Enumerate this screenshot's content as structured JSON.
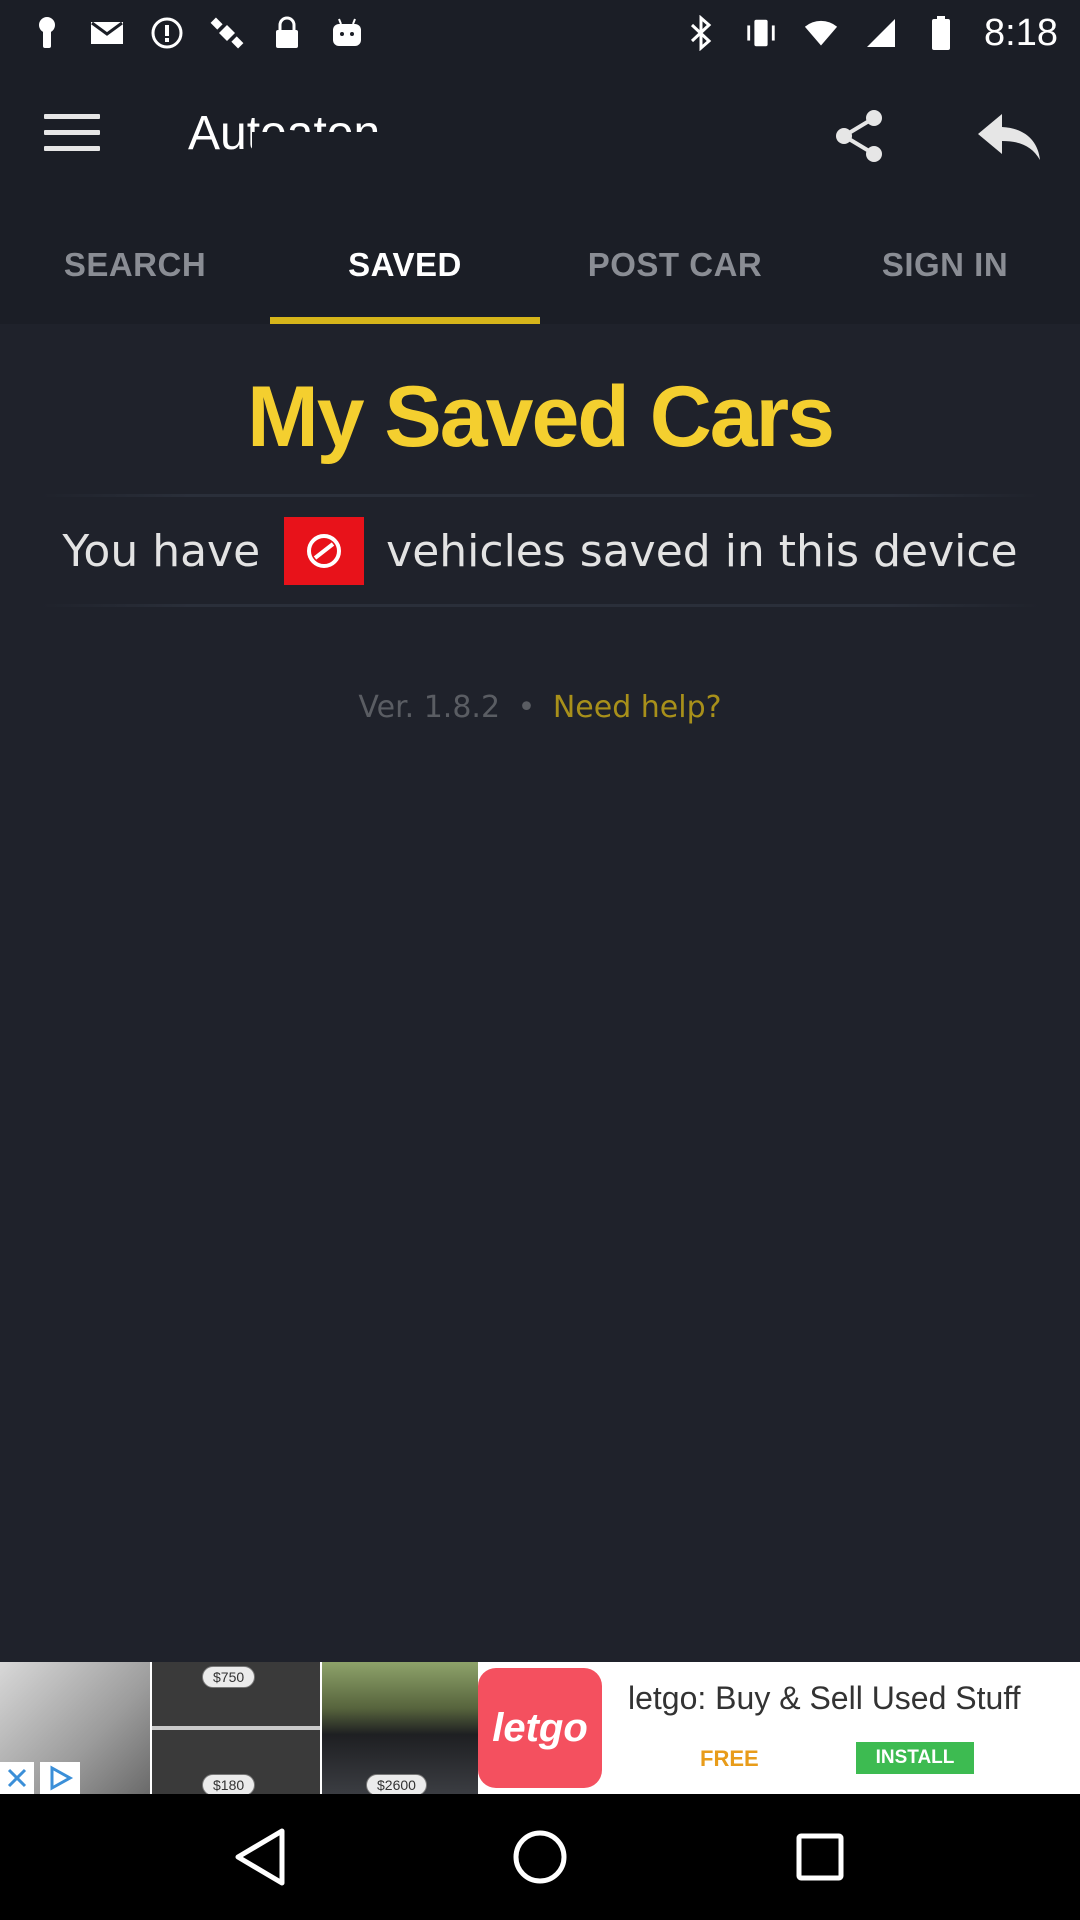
{
  "status_bar": {
    "time": "8:18",
    "left_icons": [
      "keyhole-icon",
      "mail-icon",
      "info-circle-icon",
      "satellite-icon",
      "lock-icon",
      "android-icon"
    ],
    "right_icons": [
      "bluetooth-icon",
      "vibrate-icon",
      "wifi-icon",
      "signal-icon",
      "battery-icon"
    ]
  },
  "app_bar": {
    "title": "Autoaton",
    "menu_icon": "menu-icon",
    "share_icon": "share-icon",
    "back_icon": "reply-icon"
  },
  "tabs": [
    {
      "label": "SEARCH",
      "active": false
    },
    {
      "label": "SAVED",
      "active": true
    },
    {
      "label": "POST CAR",
      "active": false
    },
    {
      "label": "SIGN IN",
      "active": false
    }
  ],
  "main": {
    "title": "My Saved Cars",
    "saved_prefix": "You have",
    "saved_suffix": "vehicles saved in this device",
    "count_icon": "no-entry-icon",
    "version": "Ver. 1.8.2",
    "separator": "•",
    "help_link": "Need help?"
  },
  "ad": {
    "headline": "letgo: Buy & Sell Used Stuff",
    "free_label": "FREE",
    "install_label": "INSTALL",
    "logo_text": "letgo",
    "prices": [
      "$750",
      "$180",
      "$2600"
    ],
    "colors": {
      "logo": "#f4505f",
      "install": "#3dbb51",
      "free": "#e89c1a"
    }
  },
  "colors": {
    "background": "#1f222b",
    "accent": "#f4cf2f",
    "tab_indicator": "#d6b51a",
    "badge": "#e8121a"
  },
  "nav": {
    "back_icon": "back-triangle-icon",
    "home_icon": "home-circle-icon",
    "recents_icon": "recents-square-icon"
  }
}
